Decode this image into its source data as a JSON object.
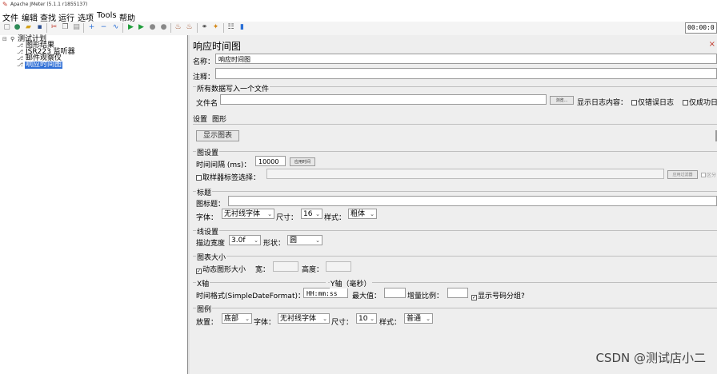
{
  "window": {
    "title": "Apache JMeter (5.1.1 r1855137)"
  },
  "menu": [
    "文件",
    "编辑",
    "查找",
    "运行",
    "选项",
    "Tools",
    "帮助"
  ],
  "toolbar": {
    "icons": [
      "new-icon",
      "templates-icon",
      "open-icon",
      "save-icon",
      "cut-icon",
      "copy-icon",
      "paste-icon",
      "expand-icon",
      "collapse-icon",
      "toggle-icon",
      "start-icon",
      "start-no-pause-icon",
      "stop-icon",
      "shutdown-icon",
      "clear-icon",
      "clear-all-icon",
      "search-icon",
      "reset-search-icon",
      "function-helper-icon",
      "help-icon"
    ],
    "timer": "00:00:0"
  },
  "tree": {
    "root": "测试计划",
    "children": [
      "图形结果",
      "JSR223 监听器",
      "邮件观察仪",
      "响应时间图"
    ],
    "selected": "响应时间图"
  },
  "panel": {
    "title": "响应时间图",
    "name_label": "名称：",
    "name_value": "响应时间图",
    "comment_label": "注释：",
    "file_section": "所有数据写入一个文件",
    "filename_label": "文件名",
    "browse_button": "浏览...",
    "log_content_label": "显示日志内容：",
    "errors_only": "仅错误日志",
    "successes_only": "仅成功日",
    "tabs": [
      "设置",
      "图形"
    ],
    "display_graph_button": "显示图表",
    "graph_settings": {
      "legend": "图设置",
      "interval_label": "时间间隔 (ms)：",
      "interval_value": "10000",
      "apply_interval_button": "应用时间",
      "sampler_label_filter": "取样器标签选择：",
      "apply_filter_button": "应用过滤器",
      "case_sensitive": "区分"
    },
    "title_section": {
      "legend": "标题",
      "graph_title_label": "图标题：",
      "font_label": "字体：",
      "font_value": "无衬线字体",
      "size_label": "尺寸：",
      "size_value": "16",
      "style_label": "样式：",
      "style_value": "粗体"
    },
    "line_section": {
      "legend": "线设置",
      "stroke_label": "描边宽度",
      "stroke_value": "3.0f",
      "shape_label": "形状：",
      "shape_value": "圆"
    },
    "size_section": {
      "legend": "图表大小",
      "dynamic_label": "动态图形大小",
      "width_label": "宽：",
      "height_label": "高度："
    },
    "x_axis": {
      "legend": "X轴",
      "format_label": "时间格式(SimpleDateFormat)：",
      "format_value": "HH:mm:ss"
    },
    "y_axis": {
      "legend": "Y轴（毫秒）",
      "max_label": "最大值：",
      "increment_label": "增量比例：",
      "group_label": "显示号码分组?"
    },
    "legend_section": {
      "legend": "图例",
      "placement_label": "放置：",
      "placement_value": "底部",
      "font_label": "字体：",
      "font_value": "无衬线字体",
      "size_label": "尺寸：",
      "size_value": "10",
      "style_label": "样式：",
      "style_value": "普通"
    }
  },
  "watermark": "CSDN @测试店小二",
  "colors": {
    "selection": "#2f6fd6",
    "panel_bg": "#eeeeee"
  }
}
